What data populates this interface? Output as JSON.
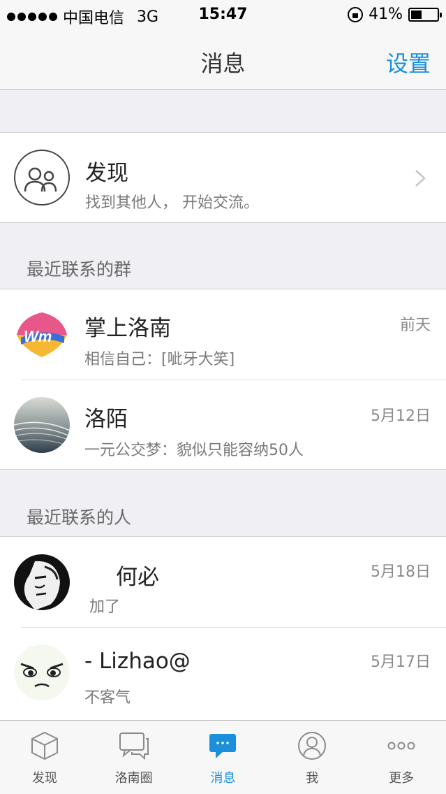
{
  "status_bar": {
    "carrier": "中国电信",
    "network": "3G",
    "time": "15:47",
    "battery_percent_label": "41%",
    "battery_level": 0.41
  },
  "nav": {
    "title": "消息",
    "settings_label": "设置"
  },
  "discover": {
    "title": "发现",
    "subtitle": "找到其他人， 开始交流。",
    "icon": "people-circle-icon"
  },
  "groups_section": {
    "header": "最近联系的群",
    "items": [
      {
        "name": "掌上洛南",
        "last_message": "相信自己：[呲牙大笑]",
        "time": "前天"
      },
      {
        "name": "洛陌",
        "last_message": "一元公交梦：貌似只能容纳50人",
        "time": "5月12日"
      }
    ]
  },
  "people_section": {
    "header": "最近联系的人",
    "items": [
      {
        "name": "何必",
        "last_message": "加了",
        "time": "5月18日"
      },
      {
        "name": "- Lizhao@",
        "last_message": "不客气",
        "time": "5月17日"
      }
    ]
  },
  "tab_bar": {
    "tabs": [
      {
        "label": "发现",
        "icon": "cube-icon",
        "active": false
      },
      {
        "label": "洛南圈",
        "icon": "chat-bubbles-icon",
        "active": false
      },
      {
        "label": "消息",
        "icon": "message-icon",
        "active": true
      },
      {
        "label": "我",
        "icon": "person-icon",
        "active": false
      },
      {
        "label": "更多",
        "icon": "more-dots-icon",
        "active": false
      }
    ]
  },
  "colors": {
    "accent": "#1a8fdc",
    "background": "#efeff4"
  }
}
